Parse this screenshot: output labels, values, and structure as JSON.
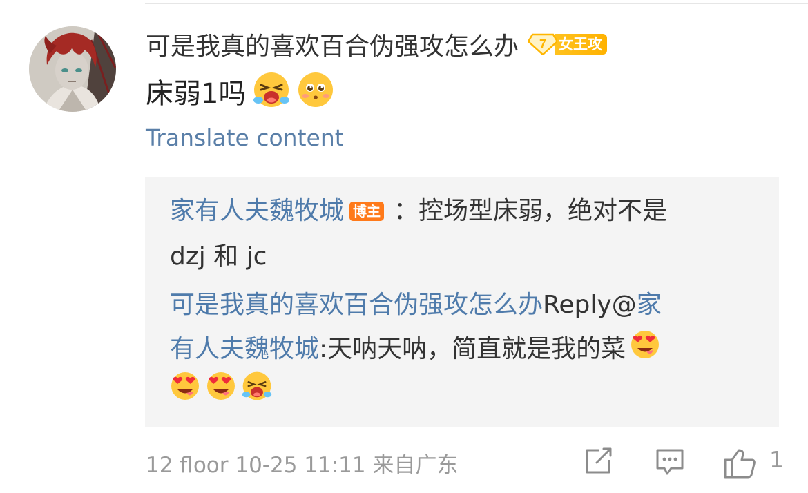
{
  "comment": {
    "username": "可是我真的喜欢百合伪强攻怎么办",
    "level": "7",
    "level_title": "女王攻",
    "text": "床弱1吗",
    "emojis": [
      "crying-laughing-emoji",
      "shy-emoji"
    ],
    "translate_label": "Translate content"
  },
  "replies": {
    "reply1": {
      "author": "家有人夫魏牧城",
      "badge": "博主",
      "text_line1": "：控场型床弱，绝对不是",
      "text_line2": "dzj 和 jc"
    },
    "reply2": {
      "author": "可是我真的喜欢百合伪强攻怎么办",
      "reply_word": " Reply@",
      "mention_line1": "家",
      "mention_line2": "有人夫魏牧城",
      "text": ":天呐天呐，简直就是我的菜",
      "emojis": [
        "heart-eyes-emoji",
        "heart-eyes-emoji",
        "heart-eyes-emoji",
        "crying-laughing-emoji"
      ]
    }
  },
  "footer": {
    "meta": "12 floor 10-25 11:11 来自广东",
    "like_count": "1"
  },
  "colors": {
    "link": "#4f7bab",
    "text": "#333333",
    "muted": "#9a9a9a",
    "reply_bg": "#f4f4f4",
    "level_badge": "#ffb200",
    "host_badge": "#ff7a1a"
  }
}
